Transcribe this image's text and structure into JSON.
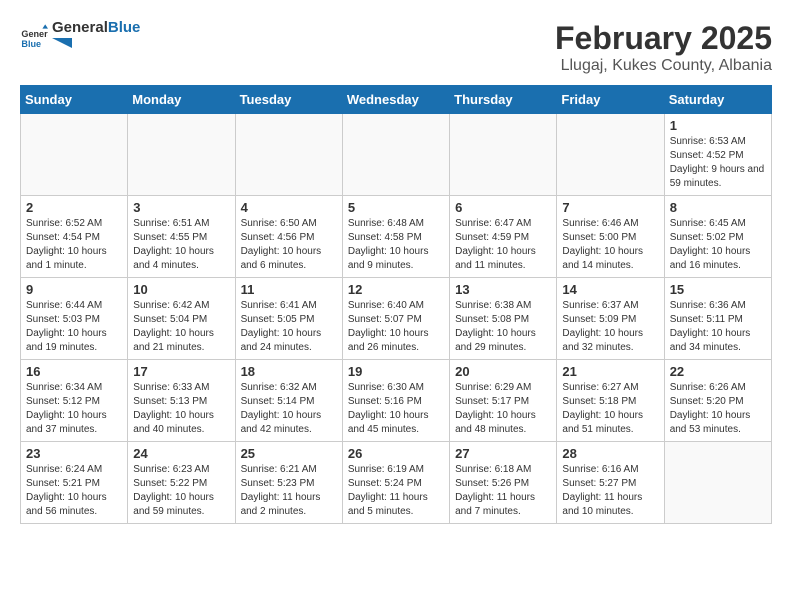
{
  "logo": {
    "general": "General",
    "blue": "Blue"
  },
  "title": "February 2025",
  "subtitle": "Llugaj, Kukes County, Albania",
  "weekdays": [
    "Sunday",
    "Monday",
    "Tuesday",
    "Wednesday",
    "Thursday",
    "Friday",
    "Saturday"
  ],
  "weeks": [
    [
      {
        "day": "",
        "info": ""
      },
      {
        "day": "",
        "info": ""
      },
      {
        "day": "",
        "info": ""
      },
      {
        "day": "",
        "info": ""
      },
      {
        "day": "",
        "info": ""
      },
      {
        "day": "",
        "info": ""
      },
      {
        "day": "1",
        "info": "Sunrise: 6:53 AM\nSunset: 4:52 PM\nDaylight: 9 hours and 59 minutes."
      }
    ],
    [
      {
        "day": "2",
        "info": "Sunrise: 6:52 AM\nSunset: 4:54 PM\nDaylight: 10 hours and 1 minute."
      },
      {
        "day": "3",
        "info": "Sunrise: 6:51 AM\nSunset: 4:55 PM\nDaylight: 10 hours and 4 minutes."
      },
      {
        "day": "4",
        "info": "Sunrise: 6:50 AM\nSunset: 4:56 PM\nDaylight: 10 hours and 6 minutes."
      },
      {
        "day": "5",
        "info": "Sunrise: 6:48 AM\nSunset: 4:58 PM\nDaylight: 10 hours and 9 minutes."
      },
      {
        "day": "6",
        "info": "Sunrise: 6:47 AM\nSunset: 4:59 PM\nDaylight: 10 hours and 11 minutes."
      },
      {
        "day": "7",
        "info": "Sunrise: 6:46 AM\nSunset: 5:00 PM\nDaylight: 10 hours and 14 minutes."
      },
      {
        "day": "8",
        "info": "Sunrise: 6:45 AM\nSunset: 5:02 PM\nDaylight: 10 hours and 16 minutes."
      }
    ],
    [
      {
        "day": "9",
        "info": "Sunrise: 6:44 AM\nSunset: 5:03 PM\nDaylight: 10 hours and 19 minutes."
      },
      {
        "day": "10",
        "info": "Sunrise: 6:42 AM\nSunset: 5:04 PM\nDaylight: 10 hours and 21 minutes."
      },
      {
        "day": "11",
        "info": "Sunrise: 6:41 AM\nSunset: 5:05 PM\nDaylight: 10 hours and 24 minutes."
      },
      {
        "day": "12",
        "info": "Sunrise: 6:40 AM\nSunset: 5:07 PM\nDaylight: 10 hours and 26 minutes."
      },
      {
        "day": "13",
        "info": "Sunrise: 6:38 AM\nSunset: 5:08 PM\nDaylight: 10 hours and 29 minutes."
      },
      {
        "day": "14",
        "info": "Sunrise: 6:37 AM\nSunset: 5:09 PM\nDaylight: 10 hours and 32 minutes."
      },
      {
        "day": "15",
        "info": "Sunrise: 6:36 AM\nSunset: 5:11 PM\nDaylight: 10 hours and 34 minutes."
      }
    ],
    [
      {
        "day": "16",
        "info": "Sunrise: 6:34 AM\nSunset: 5:12 PM\nDaylight: 10 hours and 37 minutes."
      },
      {
        "day": "17",
        "info": "Sunrise: 6:33 AM\nSunset: 5:13 PM\nDaylight: 10 hours and 40 minutes."
      },
      {
        "day": "18",
        "info": "Sunrise: 6:32 AM\nSunset: 5:14 PM\nDaylight: 10 hours and 42 minutes."
      },
      {
        "day": "19",
        "info": "Sunrise: 6:30 AM\nSunset: 5:16 PM\nDaylight: 10 hours and 45 minutes."
      },
      {
        "day": "20",
        "info": "Sunrise: 6:29 AM\nSunset: 5:17 PM\nDaylight: 10 hours and 48 minutes."
      },
      {
        "day": "21",
        "info": "Sunrise: 6:27 AM\nSunset: 5:18 PM\nDaylight: 10 hours and 51 minutes."
      },
      {
        "day": "22",
        "info": "Sunrise: 6:26 AM\nSunset: 5:20 PM\nDaylight: 10 hours and 53 minutes."
      }
    ],
    [
      {
        "day": "23",
        "info": "Sunrise: 6:24 AM\nSunset: 5:21 PM\nDaylight: 10 hours and 56 minutes."
      },
      {
        "day": "24",
        "info": "Sunrise: 6:23 AM\nSunset: 5:22 PM\nDaylight: 10 hours and 59 minutes."
      },
      {
        "day": "25",
        "info": "Sunrise: 6:21 AM\nSunset: 5:23 PM\nDaylight: 11 hours and 2 minutes."
      },
      {
        "day": "26",
        "info": "Sunrise: 6:19 AM\nSunset: 5:24 PM\nDaylight: 11 hours and 5 minutes."
      },
      {
        "day": "27",
        "info": "Sunrise: 6:18 AM\nSunset: 5:26 PM\nDaylight: 11 hours and 7 minutes."
      },
      {
        "day": "28",
        "info": "Sunrise: 6:16 AM\nSunset: 5:27 PM\nDaylight: 11 hours and 10 minutes."
      },
      {
        "day": "",
        "info": ""
      }
    ]
  ]
}
